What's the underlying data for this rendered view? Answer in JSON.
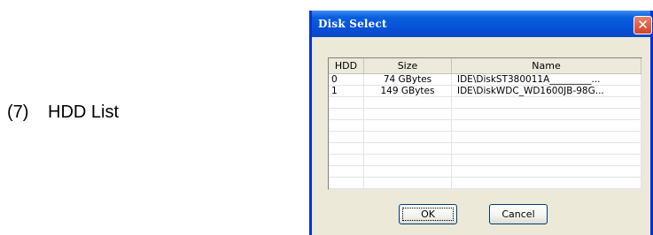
{
  "caption": {
    "number": "(7)",
    "text": "HDD List"
  },
  "dialog": {
    "title": "Disk Select",
    "close_glyph": "✕",
    "columns": [
      "HDD",
      "Size",
      "Name"
    ],
    "rows": [
      {
        "hdd": "0",
        "size": "74 GBytes",
        "name": "IDE\\DiskST380011A_________..."
      },
      {
        "hdd": "1",
        "size": "149 GBytes",
        "name": "IDE\\DiskWDC_WD1600JB-98G..."
      }
    ],
    "ok_label": "OK",
    "cancel_label": "Cancel"
  }
}
